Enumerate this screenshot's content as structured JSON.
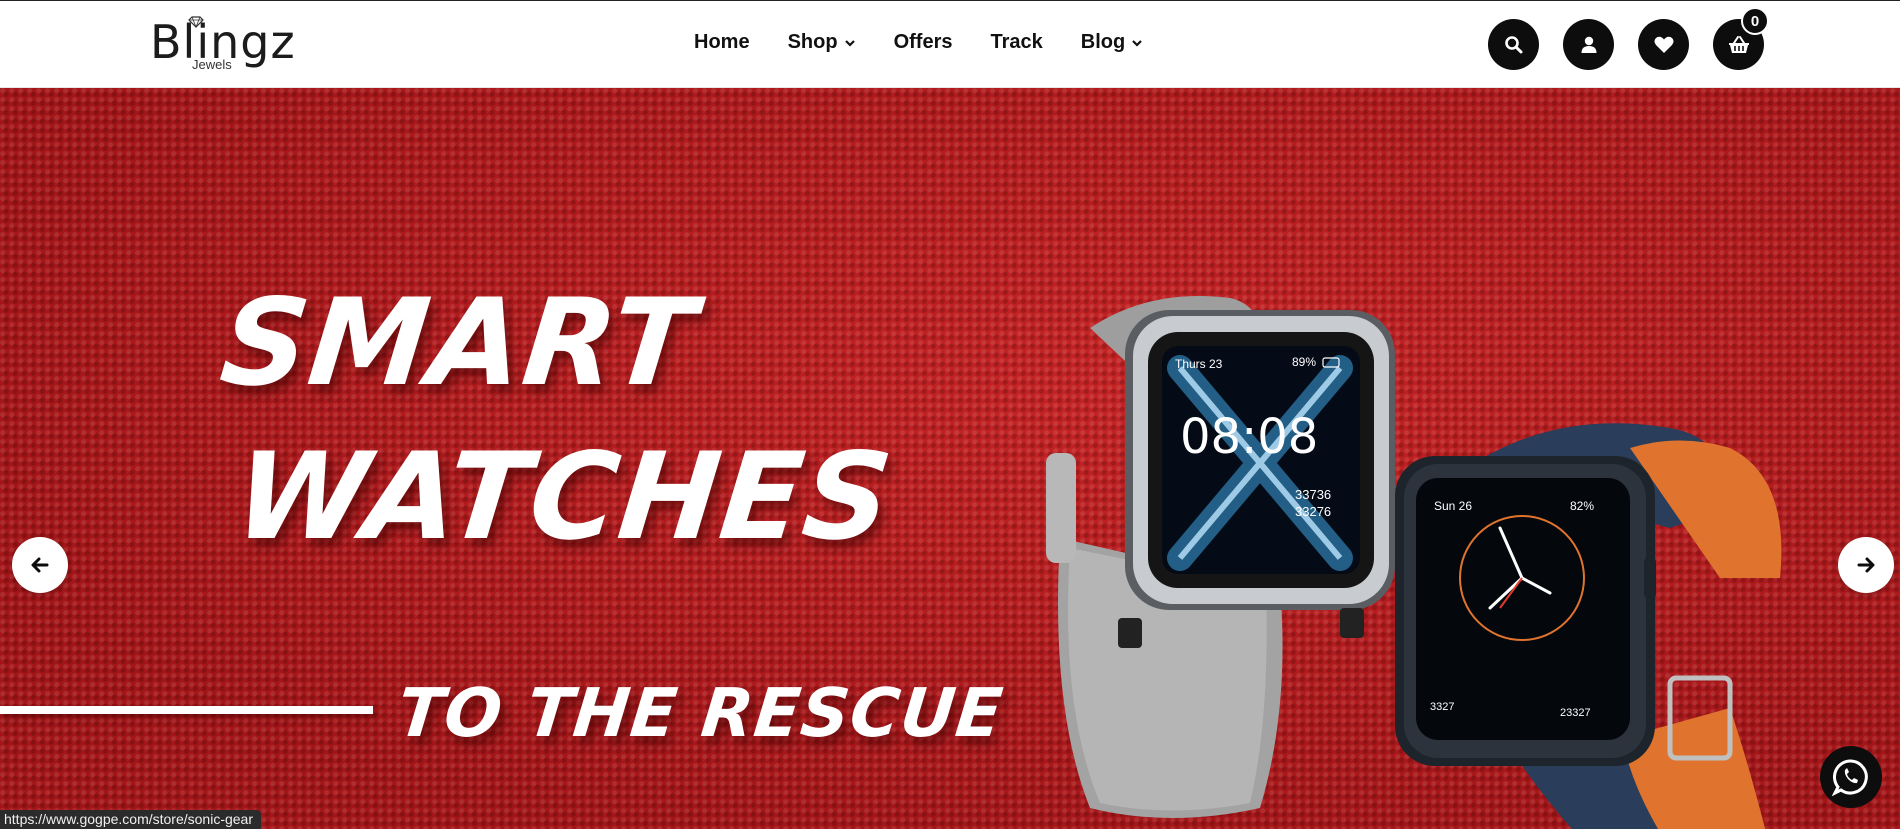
{
  "brand": {
    "name": "Blingz",
    "subtitle": "Jewels"
  },
  "nav": {
    "items": [
      {
        "label": "Home",
        "has_dropdown": false
      },
      {
        "label": "Shop",
        "has_dropdown": true
      },
      {
        "label": "Offers",
        "has_dropdown": false
      },
      {
        "label": "Track",
        "has_dropdown": false
      },
      {
        "label": "Blog",
        "has_dropdown": true
      }
    ]
  },
  "header_actions": {
    "search_icon": "search-icon",
    "account_icon": "user-icon",
    "wishlist_icon": "heart-icon",
    "cart_icon": "basket-icon",
    "cart_count": "0"
  },
  "hero": {
    "line1": "SMART",
    "line2": "WATCHES",
    "line3": "TO THE RESCUE",
    "background_color": "#b71f22",
    "watch1": {
      "date": "Thurs 23",
      "battery": "89%",
      "time": "08:08",
      "stat1": "33736",
      "stat2": "33276"
    },
    "watch2": {
      "date": "Sun 26",
      "battery": "82%",
      "stat_left": "3327",
      "stat_right": "23327"
    }
  },
  "carousel": {
    "prev_icon": "arrow-left-icon",
    "next_icon": "arrow-right-icon"
  },
  "whatsapp": {
    "icon": "whatsapp-icon"
  },
  "status_bar": {
    "url": "https://www.gogpe.com/store/sonic-gear"
  }
}
